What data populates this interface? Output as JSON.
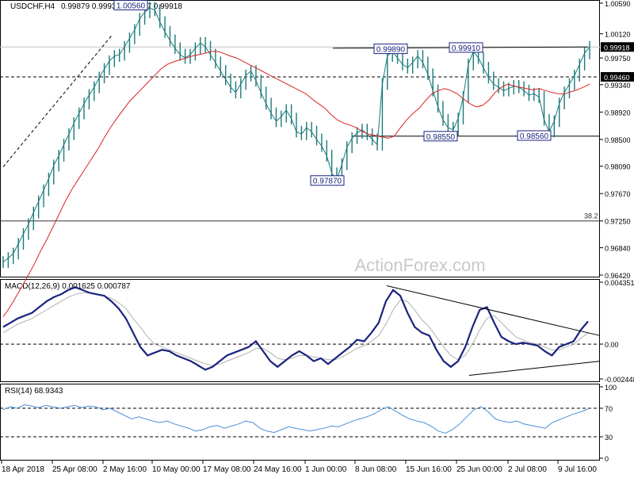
{
  "header": {
    "symbol": "USDCHF,H4",
    "ohlc": "0.99879 0.99936 0.99857 0.99918"
  },
  "watermark": "ActionForex.com",
  "colors": {
    "price": "#1b7a7a",
    "sma": "#dd2222",
    "macd_line": "#1a237e",
    "macd_signal": "#b0b0b0",
    "rsi": "#4a90d9",
    "label_border": "#1a237e"
  },
  "chart_data": [
    {
      "type": "line",
      "panel": "price",
      "title": "USDCHF,H4",
      "ylim": [
        0.9642,
        1.0059
      ],
      "y_ticks": [
        "1.00590",
        "1.00120",
        "0.99750",
        "0.99340",
        "0.98920",
        "0.98500",
        "0.98090",
        "0.97670",
        "0.97250",
        "0.96840",
        "0.96420"
      ],
      "x_ticks": [
        "18 Apr 2018",
        "25 Apr 08:00",
        "2 May 16:00",
        "10 May 00:00",
        "17 May 08:00",
        "24 May 16:00",
        "1 Jun 00:00",
        "8 Jun 08:00",
        "15 Jun 16:00",
        "25 Jun 00:00",
        "2 Jul 08:00",
        "9 Jul 16:00"
      ],
      "price_labels": [
        {
          "text": "1.00560",
          "price": 1.0056
        },
        {
          "text": "0.99890",
          "price": 0.9989
        },
        {
          "text": "0.99910",
          "price": 0.9991
        },
        {
          "text": "0.98550",
          "price": 0.9855
        },
        {
          "text": "0.98560",
          "price": 0.9856
        },
        {
          "text": "0.97870",
          "price": 0.9787
        }
      ],
      "axis_tags": [
        {
          "text": "0.99918",
          "price": 0.99918
        },
        {
          "text": "0.99460",
          "price": 0.9946
        }
      ],
      "level_lines": {
        "current": 0.99918,
        "dashed": 0.9946,
        "fib": 0.9725,
        "support": 0.9855
      },
      "fib_label": "38.2",
      "resistance_trendline": [
        [
          0.999
        ],
        [
          0.99918
        ]
      ],
      "series": [
        {
          "name": "",
          "close": [
            0.9662,
            0.9668,
            0.9675,
            0.969,
            0.9705,
            0.972,
            0.9738,
            0.9755,
            0.9772,
            0.979,
            0.981,
            0.9825,
            0.9842,
            0.9858,
            0.9875,
            0.989,
            0.9905,
            0.9918,
            0.993,
            0.9945,
            0.9958,
            0.997,
            0.9978,
            0.998,
            0.9992,
            1.0005,
            1.0018,
            1.0035,
            1.0045,
            1.0052,
            1.0048,
            1.003,
            1.0015,
            1.0002,
            0.999,
            0.998,
            0.9975,
            0.998,
            0.999,
            0.9998,
            0.9992,
            0.998,
            0.9968,
            0.9955,
            0.9942,
            0.993,
            0.9922,
            0.9935,
            0.9948,
            0.9955,
            0.994,
            0.9922,
            0.9905,
            0.989,
            0.9878,
            0.9885,
            0.9895,
            0.9882,
            0.9862,
            0.9858,
            0.9868,
            0.9862,
            0.985,
            0.984,
            0.9825,
            0.9798,
            0.9788,
            0.9812,
            0.9838,
            0.9852,
            0.986,
            0.9865,
            0.9858,
            0.985,
            0.9842,
            0.9935,
            0.9978,
            0.9985,
            0.9975,
            0.9965,
            0.996,
            0.9968,
            0.9978,
            0.9968,
            0.995,
            0.9925,
            0.99,
            0.988,
            0.9868,
            0.9865,
            0.9882,
            0.9915,
            0.9965,
            0.9985,
            0.9975,
            0.996,
            0.9945,
            0.9935,
            0.993,
            0.9925,
            0.9928,
            0.9932,
            0.993,
            0.9925,
            0.9918,
            0.992,
            0.9915,
            0.988,
            0.9862,
            0.9878,
            0.9905,
            0.9922,
            0.9935,
            0.9948,
            0.9965,
            0.9982,
            0.99918
          ]
        },
        {
          "name": "",
          "sma": [
            0.9578,
            0.9592,
            0.9608,
            0.9625,
            0.9642,
            0.966,
            0.968,
            0.9698,
            0.9718,
            0.9738,
            0.9758,
            0.9775,
            0.979,
            0.9805,
            0.982,
            0.9835,
            0.9852,
            0.9868,
            0.9882,
            0.9895,
            0.9908,
            0.9918,
            0.9928,
            0.9938,
            0.9948,
            0.9958,
            0.9965,
            0.9969,
            0.9972,
            0.9975,
            0.9978,
            0.998,
            0.9982,
            0.9985,
            0.9985,
            0.9982,
            0.9978,
            0.9975,
            0.997,
            0.9965,
            0.996,
            0.9955,
            0.995,
            0.9945,
            0.994,
            0.9935,
            0.993,
            0.9925,
            0.992,
            0.9912,
            0.9905,
            0.9898,
            0.9888,
            0.988,
            0.9875,
            0.9872,
            0.9868,
            0.9862,
            0.9858,
            0.9856,
            0.9854,
            0.9852,
            0.9855,
            0.9868,
            0.988,
            0.989,
            0.9898,
            0.991,
            0.992,
            0.9925,
            0.9928,
            0.9925,
            0.992,
            0.9912,
            0.9905,
            0.99,
            0.9902,
            0.991,
            0.9922,
            0.993,
            0.9935,
            0.9932,
            0.993,
            0.9928,
            0.9926,
            0.9928,
            0.9925,
            0.9922,
            0.992,
            0.992,
            0.9923,
            0.9926,
            0.993,
            0.9935
          ]
        }
      ]
    },
    {
      "type": "line",
      "panel": "macd",
      "title": "MACD(12,26,9) 0.001625 0.000787",
      "ylim": [
        -0.002448,
        0.004351
      ],
      "y_ticks": [
        "0.004351",
        "0.00",
        "-0.002448"
      ],
      "series": [
        {
          "name": "",
          "macd": [
            0.0012,
            0.0015,
            0.0018,
            0.002,
            0.0022,
            0.0026,
            0.003,
            0.0033,
            0.0035,
            0.0038,
            0.004,
            0.0038,
            0.0036,
            0.0035,
            0.0034,
            0.003,
            0.0025,
            0.0018,
            0.0008,
            -0.0002,
            -0.0008,
            -0.0006,
            -0.0004,
            -0.0005,
            -0.0008,
            -0.001,
            -0.0012,
            -0.0015,
            -0.0018,
            -0.0016,
            -0.0012,
            -0.0008,
            -0.0006,
            -0.0004,
            -0.0002,
            0.0002,
            -0.0005,
            -0.0012,
            -0.0016,
            -0.0012,
            -0.0008,
            -0.0005,
            -0.0008,
            -0.0012,
            -0.001,
            -0.0014,
            -0.001,
            -0.0006,
            -0.0002,
            0.0003,
            0.0002,
            0.0008,
            0.0015,
            0.003,
            0.0038,
            0.0034,
            0.0022,
            0.0012,
            0.0008,
            0.0006,
            -0.0004,
            -0.0012,
            -0.0016,
            -0.0012,
            -0.0002,
            0.0012,
            0.0024,
            0.0026,
            0.0015,
            0.0005,
            0.0002,
            0.0,
            0.0001,
            0.0,
            -0.0001,
            -0.0005,
            -0.0008,
            -0.0002,
            0.0,
            0.0002,
            0.001,
            0.0016
          ]
        },
        {
          "name": "",
          "signal": [
            0.0008,
            0.0011,
            0.0014,
            0.0016,
            0.0018,
            0.0021,
            0.0024,
            0.0027,
            0.003,
            0.0033,
            0.0035,
            0.0036,
            0.0036,
            0.0035,
            0.0034,
            0.0032,
            0.0029,
            0.0025,
            0.0018,
            0.0012,
            0.0005,
            0.0,
            -0.0002,
            -0.0004,
            -0.0006,
            -0.0008,
            -0.001,
            -0.0012,
            -0.0014,
            -0.0015,
            -0.0014,
            -0.0012,
            -0.001,
            -0.0008,
            -0.0006,
            -0.0003,
            -0.0003,
            -0.0006,
            -0.001,
            -0.0011,
            -0.001,
            -0.0008,
            -0.0008,
            -0.0009,
            -0.001,
            -0.0011,
            -0.0011,
            -0.0009,
            -0.0006,
            -0.0003,
            -0.0001,
            0.0002,
            0.0006,
            0.0014,
            0.0024,
            0.0031,
            0.003,
            0.0024,
            0.0017,
            0.0012,
            0.0005,
            -0.0002,
            -0.0008,
            -0.0011,
            -0.0008,
            0.0,
            0.001,
            0.0018,
            0.002,
            0.0015,
            0.001,
            0.0005,
            0.0003,
            0.0001,
            0.0,
            -0.0002,
            -0.0004,
            -0.0004,
            -0.0002,
            0.0,
            0.0004,
            0.0008
          ]
        }
      ],
      "trendline_upper": [
        0.0041,
        0.0006
      ],
      "trendline_lower": [
        -0.0022,
        -0.0012
      ]
    },
    {
      "type": "line",
      "panel": "rsi",
      "title": "RSI(14) 68.9343",
      "ylim": [
        0,
        100
      ],
      "y_ticks": [
        "100",
        "70",
        "30",
        "0"
      ],
      "levels": [
        70,
        30
      ],
      "series": [
        {
          "name": "",
          "values": [
            68,
            72,
            70,
            75,
            73,
            71,
            74,
            72,
            70,
            72,
            74,
            71,
            73,
            72,
            68,
            70,
            65,
            60,
            55,
            58,
            55,
            52,
            50,
            52,
            48,
            45,
            42,
            38,
            40,
            44,
            46,
            42,
            45,
            48,
            52,
            50,
            42,
            38,
            36,
            40,
            44,
            42,
            40,
            38,
            40,
            42,
            45,
            44,
            48,
            52,
            55,
            58,
            62,
            68,
            72,
            66,
            60,
            55,
            52,
            50,
            45,
            38,
            35,
            40,
            48,
            58,
            68,
            72,
            65,
            55,
            52,
            50,
            52,
            48,
            46,
            44,
            42,
            50,
            54,
            58,
            62,
            65,
            68.9343
          ]
        }
      ]
    }
  ]
}
